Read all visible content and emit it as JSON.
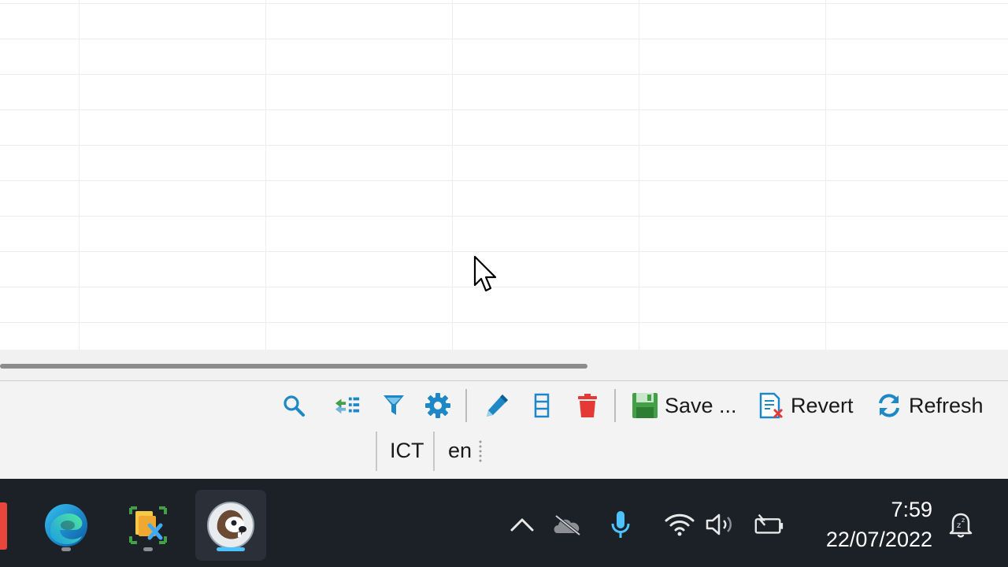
{
  "toolbar": {
    "search_icon": "search-icon",
    "save_label": "Save ...",
    "revert_label": "Revert",
    "refresh_label": "Refresh"
  },
  "statusbar": {
    "timezone": "ICT",
    "locale": "en"
  },
  "taskbar": {
    "apps": [
      "edge-browser-icon",
      "dev-tools-app-icon",
      "dbeaver-app-icon"
    ],
    "active_app": "dbeaver-app-icon"
  },
  "system_tray": {
    "time": "7:59",
    "date": "22/07/2022"
  },
  "colors": {
    "toolbar_blue": "#1e88c7",
    "delete_red": "#e53935",
    "save_green": "#43a047",
    "taskbar_bg": "#1c2128",
    "active_indicator": "#4cc2ff"
  }
}
